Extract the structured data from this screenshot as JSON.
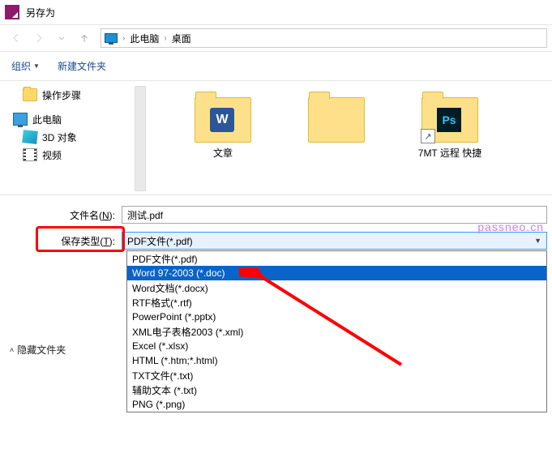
{
  "window": {
    "title": "另存为"
  },
  "address": {
    "root": "此电脑",
    "folder": "桌面"
  },
  "toolbar": {
    "organize": "组织",
    "newfolder": "新建文件夹"
  },
  "tree": {
    "steps": "操作步骤",
    "thispc": "此电脑",
    "obj3d": "3D 对象",
    "video": "视频"
  },
  "files": {
    "item1": "文章",
    "item2": "",
    "item3": "7MT 远程   快捷",
    "ps_badge": "Ps",
    "w_badge": "W"
  },
  "fields": {
    "filename_label_pre": "文件名(",
    "filename_label_key": "N",
    "filename_label_post": "):",
    "savetype_label_pre": "保存类型(",
    "savetype_label_key": "T",
    "savetype_label_post": "):",
    "filename_value": "测试.pdf",
    "savetype_value": "PDF文件(*.pdf)"
  },
  "options": {
    "o0": "PDF文件(*.pdf)",
    "o1": "Word 97-2003 (*.doc)",
    "o2": "Word文档(*.docx)",
    "o3": "RTF格式(*.rtf)",
    "o4": "PowerPoint (*.pptx)",
    "o5": "XML电子表格2003 (*.xml)",
    "o6": "Excel (*.xlsx)",
    "o7": "HTML (*.htm;*.html)",
    "o8": "TXT文件(*.txt)",
    "o9": "辅助文本 (*.txt)",
    "o10": "PNG (*.png)"
  },
  "hide_folders": "隐藏文件夹",
  "watermark": "passneo.cn"
}
